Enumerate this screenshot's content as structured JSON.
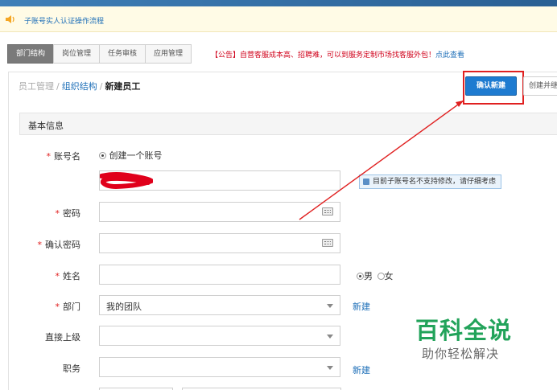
{
  "notice": {
    "text": "子账号实人认证操作流程"
  },
  "tabs": [
    {
      "label": "部门结构",
      "active": true
    },
    {
      "label": "岗位管理",
      "active": false
    },
    {
      "label": "任务审核",
      "active": false
    },
    {
      "label": "应用管理",
      "active": false
    }
  ],
  "announcement": {
    "text": "【公告】自营客服成本高、招聘难，可以到服务定制市场找客服外包！",
    "link": "点此查看"
  },
  "breadcrumb": {
    "item1": "员工管理",
    "item2": "组织结构",
    "current": "新建员工",
    "sep": "/"
  },
  "actions": {
    "confirm_label": "确认新建",
    "create_continue_label": "创建并继续"
  },
  "section": {
    "title": "基本信息"
  },
  "form": {
    "required_mark": "*",
    "account": {
      "label": "账号名",
      "radio_label": "创建一个账号",
      "hint": "目前子账号名不支持修改，请仔细考虑"
    },
    "password": {
      "label": "密码"
    },
    "confirm_password": {
      "label": "确认密码"
    },
    "name": {
      "label": "姓名",
      "gender_male": "男",
      "gender_female": "女"
    },
    "department": {
      "label": "部门",
      "value": "我的团队",
      "new_link": "新建"
    },
    "supervisor": {
      "label": "直接上级"
    },
    "position": {
      "label": "职务",
      "new_link": "新建"
    }
  },
  "watermark": {
    "title": "百科全说",
    "subtitle": "助你轻松解决"
  },
  "colors": {
    "accent": "#1e7bd0",
    "highlight": "#e02020",
    "brand_green": "#22a35a"
  }
}
